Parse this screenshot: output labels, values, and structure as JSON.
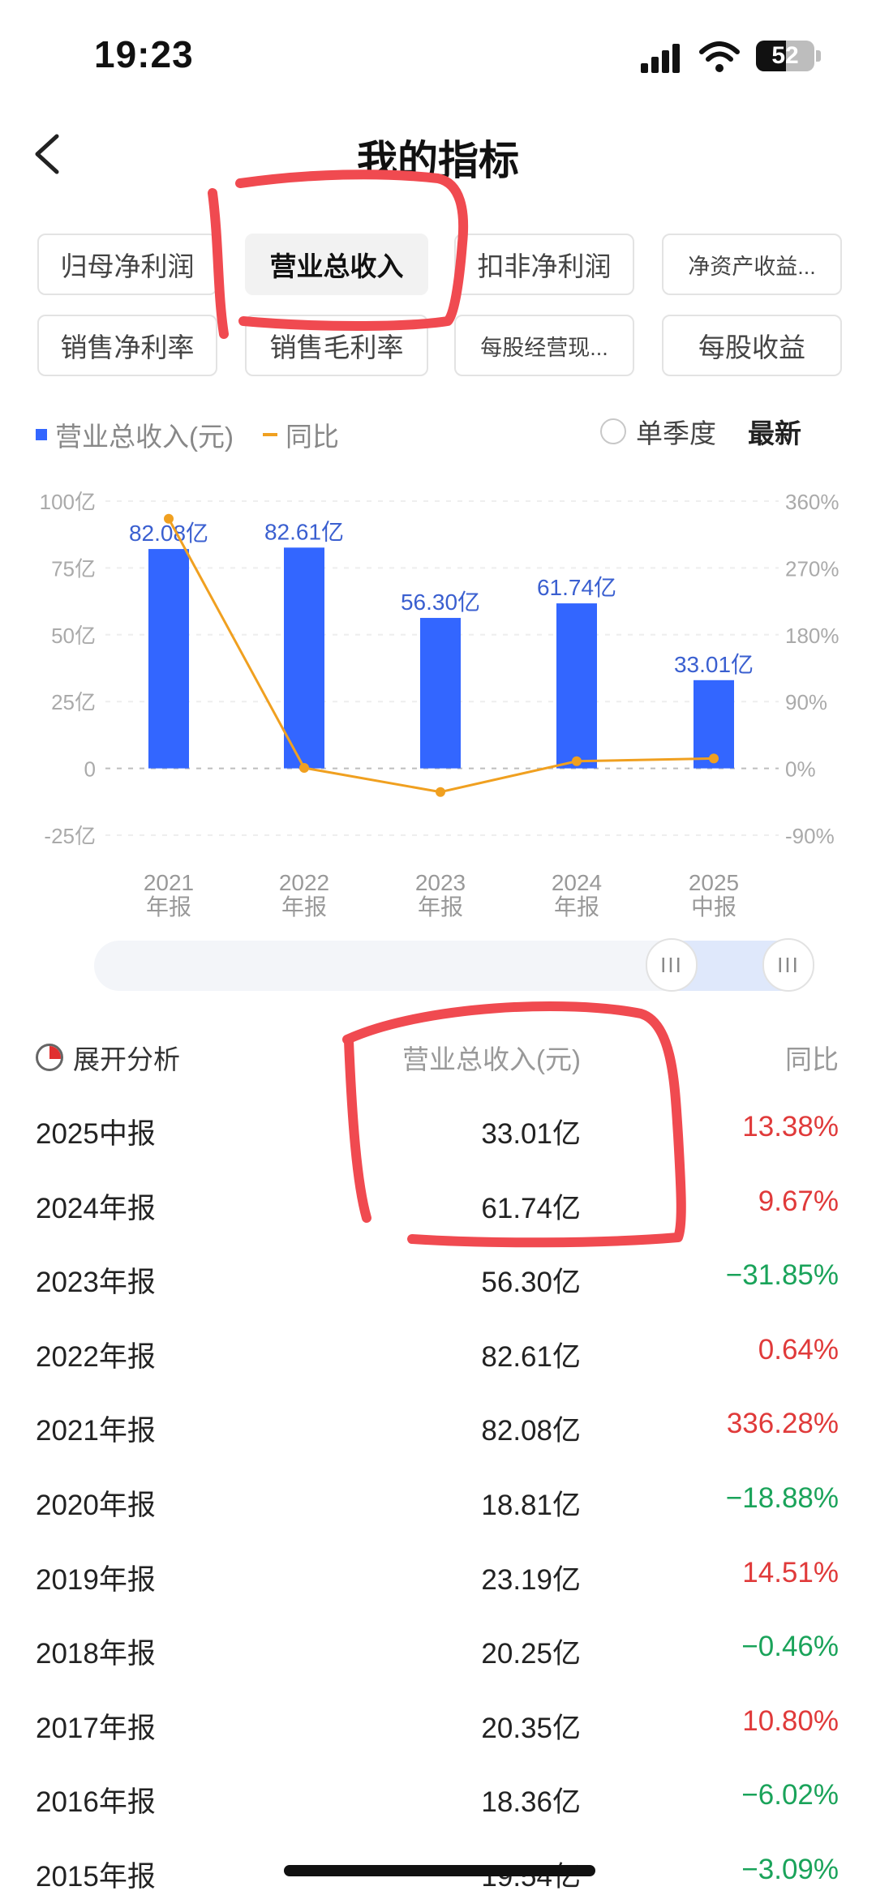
{
  "status": {
    "time": "19:23",
    "battery": "52",
    "battery_level": 0.52
  },
  "header": {
    "title": "我的指标"
  },
  "tabs": [
    {
      "label": "归母净利润",
      "active": false
    },
    {
      "label": "营业总收入",
      "active": true
    },
    {
      "label": "扣非净利润",
      "active": false
    },
    {
      "label": "净资产收益...",
      "active": false
    },
    {
      "label": "销售净利率",
      "active": false
    },
    {
      "label": "销售毛利率",
      "active": false
    },
    {
      "label": "每股经营现...",
      "active": false
    },
    {
      "label": "每股收益",
      "active": false
    }
  ],
  "legend": {
    "bar": "营业总收入(元)",
    "line": "同比",
    "single_quarter": "单季度",
    "latest": "最新"
  },
  "colors": {
    "bar": "#3366ff",
    "line": "#f0a020",
    "up": "#e03a3a",
    "down": "#1aa35a",
    "annotation": "#f04a50"
  },
  "chart_data": {
    "type": "bar",
    "categories": [
      "2021\n年报",
      "2022\n年报",
      "2023\n年报",
      "2024\n年报",
      "2025\n中报"
    ],
    "series": [
      {
        "name": "营业总收入(元)",
        "type": "bar",
        "axis": "left",
        "values": [
          82.08,
          82.61,
          56.3,
          61.74,
          33.01
        ]
      },
      {
        "name": "同比",
        "type": "line",
        "axis": "right",
        "values": [
          336.28,
          0.64,
          -31.85,
          9.67,
          13.38
        ]
      }
    ],
    "data_labels": [
      "82.08亿",
      "82.61亿",
      "56.30亿",
      "61.74亿",
      "33.01亿"
    ],
    "y_left": {
      "range": [
        -25,
        100
      ],
      "ticks": [
        "100亿",
        "75亿",
        "50亿",
        "25亿",
        "0",
        "-25亿"
      ]
    },
    "y_right": {
      "range": [
        -90,
        360
      ],
      "ticks": [
        "360%",
        "270%",
        "180%",
        "90%",
        "0%",
        "-90%"
      ]
    },
    "grid": "dashed horizontal"
  },
  "table": {
    "head": {
      "analysis": "展开分析",
      "revenue": "营业总收入(元)",
      "yoy": "同比"
    },
    "rows": [
      {
        "period": "2025中报",
        "revenue": "33.01亿",
        "yoy": "13.38%",
        "dir": "up"
      },
      {
        "period": "2024年报",
        "revenue": "61.74亿",
        "yoy": "9.67%",
        "dir": "up"
      },
      {
        "period": "2023年报",
        "revenue": "56.30亿",
        "yoy": "−31.85%",
        "dir": "down"
      },
      {
        "period": "2022年报",
        "revenue": "82.61亿",
        "yoy": "0.64%",
        "dir": "up"
      },
      {
        "period": "2021年报",
        "revenue": "82.08亿",
        "yoy": "336.28%",
        "dir": "up"
      },
      {
        "period": "2020年报",
        "revenue": "18.81亿",
        "yoy": "−18.88%",
        "dir": "down"
      },
      {
        "period": "2019年报",
        "revenue": "23.19亿",
        "yoy": "14.51%",
        "dir": "up"
      },
      {
        "period": "2018年报",
        "revenue": "20.25亿",
        "yoy": "−0.46%",
        "dir": "down"
      },
      {
        "period": "2017年报",
        "revenue": "20.35亿",
        "yoy": "10.80%",
        "dir": "up"
      },
      {
        "period": "2016年报",
        "revenue": "18.36亿",
        "yoy": "−6.02%",
        "dir": "down"
      },
      {
        "period": "2015年报",
        "revenue": "19.54亿",
        "yoy": "−3.09%",
        "dir": "down"
      }
    ]
  }
}
